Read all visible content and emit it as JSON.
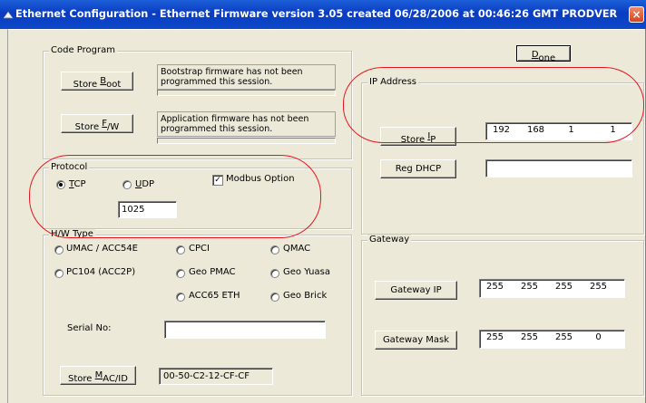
{
  "window": {
    "title": "Ethernet Configuration  -  Ethernet Firmware version 3.05 created 06/28/2006 at 00:46:26 GMT PRODVER",
    "close_label": "×"
  },
  "done_button": {
    "label_pre": "",
    "mnemonic": "D",
    "label_post": "one"
  },
  "code_program": {
    "title": "Code Program",
    "store_boot": {
      "label_pre": "Store ",
      "mnemonic": "B",
      "label_post": "oot"
    },
    "boot_status": "Bootstrap firmware has not been programmed this session.",
    "boot_progress": 0,
    "store_fw": {
      "label_pre": "Store ",
      "mnemonic": "F",
      "label_post": "/W"
    },
    "fw_status": "Application firmware has not been programmed this session.",
    "fw_progress": 0
  },
  "protocol": {
    "title": "Protocol",
    "tcp": {
      "mnemonic": "T",
      "label_post": "CP",
      "selected": true
    },
    "udp": {
      "mnemonic": "U",
      "label_post": "DP",
      "selected": false
    },
    "modbus": {
      "label": "Modbus Option",
      "checked": true
    },
    "port_value": "1025"
  },
  "hw_type": {
    "title": "H/W Type",
    "options": [
      {
        "label": "UMAC / ACC54E",
        "selected": false
      },
      {
        "label": "CPCI",
        "selected": false
      },
      {
        "label": "QMAC",
        "selected": false
      },
      {
        "label": "PC104 (ACC2P)",
        "selected": false
      },
      {
        "label": "Geo PMAC",
        "selected": false
      },
      {
        "label": "Geo Yuasa",
        "selected": false
      },
      {
        "label": "ACC65 ETH",
        "selected": false
      },
      {
        "label": "Geo Brick",
        "selected": false
      }
    ],
    "serial_label": "Serial No:",
    "serial_value": "",
    "store_mac": {
      "label_pre": "Store ",
      "mnemonic": "M",
      "label_post": "AC/ID"
    },
    "mac_value": "00-50-C2-12-CF-CF"
  },
  "ip_address": {
    "title": "IP Address",
    "store_ip": {
      "label_pre": "Store ",
      "mnemonic": "I",
      "label_post": "P"
    },
    "octets": [
      "192",
      "168",
      "1",
      "1"
    ],
    "reg_dhcp": {
      "label": "Reg DHCP"
    },
    "dhcp_value": ""
  },
  "gateway": {
    "title": "Gateway",
    "gateway_ip": {
      "label": "Gateway IP",
      "octets": [
        "255",
        "255",
        "255",
        "255"
      ]
    },
    "gateway_mask": {
      "label": "Gateway Mask",
      "octets": [
        "255",
        "255",
        "255",
        "0"
      ]
    }
  },
  "colors": {
    "titlebar": "#0a3cc1",
    "face": "#ece9d8",
    "highlight_ring": "#e8141e"
  }
}
